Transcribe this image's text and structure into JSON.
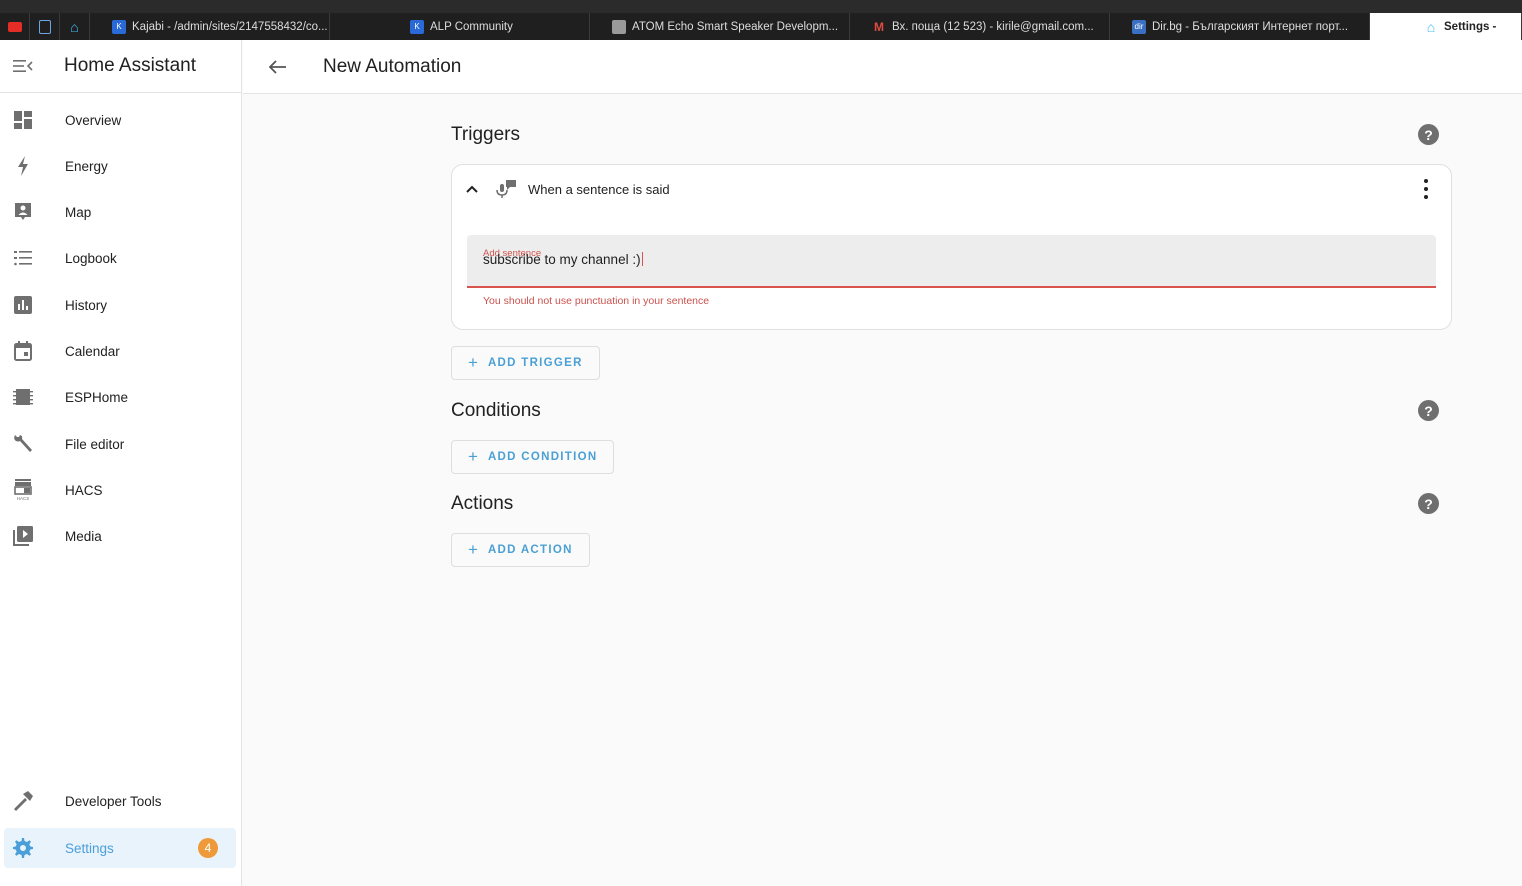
{
  "browser": {
    "tabs": [
      {
        "label": "Kajabi - /admin/sites/2147558432/co...",
        "icon": "kajabi-icon",
        "color": "#2a6ad8"
      },
      {
        "label": "ALP Community",
        "icon": "kajabi-icon",
        "color": "#2a6ad8"
      },
      {
        "label": "ATOM Echo Smart Speaker Developm...",
        "icon": "atom-icon",
        "color": "#9a9a9a"
      },
      {
        "label": "Вх. поща (12 523) - kirile@gmail.com...",
        "icon": "gmail-icon",
        "color": "#e04a3f"
      },
      {
        "label": "Dir.bg - Българският Интернет порт...",
        "icon": "dirbg-icon",
        "color": "#3b6fc4"
      },
      {
        "label": "Settings -",
        "icon": "home-assistant-icon",
        "color": "#41bdf5"
      }
    ]
  },
  "sidebar": {
    "title": "Home Assistant",
    "items": [
      {
        "label": "Overview",
        "icon": "dashboard-icon"
      },
      {
        "label": "Energy",
        "icon": "lightning-icon"
      },
      {
        "label": "Map",
        "icon": "map-person-icon"
      },
      {
        "label": "Logbook",
        "icon": "list-icon"
      },
      {
        "label": "History",
        "icon": "chart-box-icon"
      },
      {
        "label": "Calendar",
        "icon": "calendar-icon"
      },
      {
        "label": "ESPHome",
        "icon": "chip-icon"
      },
      {
        "label": "File editor",
        "icon": "wrench-icon"
      },
      {
        "label": "HACS",
        "icon": "hacs-icon"
      },
      {
        "label": "Media",
        "icon": "media-play-icon"
      }
    ],
    "bottom": [
      {
        "label": "Developer Tools",
        "icon": "hammer-icon"
      },
      {
        "label": "Settings",
        "icon": "gear-icon",
        "badge": "4",
        "active": true
      }
    ]
  },
  "header": {
    "title": "New Automation"
  },
  "triggers": {
    "title": "Triggers",
    "card": {
      "label": "When a sentence is said",
      "field_label": "Add sentence",
      "field_value": "subscribe to my channel :)",
      "error": "You should not use punctuation in your sentence"
    },
    "add_label": "ADD TRIGGER"
  },
  "conditions": {
    "title": "Conditions",
    "add_label": "ADD CONDITION"
  },
  "actions": {
    "title": "Actions",
    "add_label": "ADD ACTION"
  },
  "help_glyph": "?",
  "colors": {
    "accent": "#4aa0d4",
    "error": "#d9534f",
    "badge": "#ef9a3a"
  }
}
